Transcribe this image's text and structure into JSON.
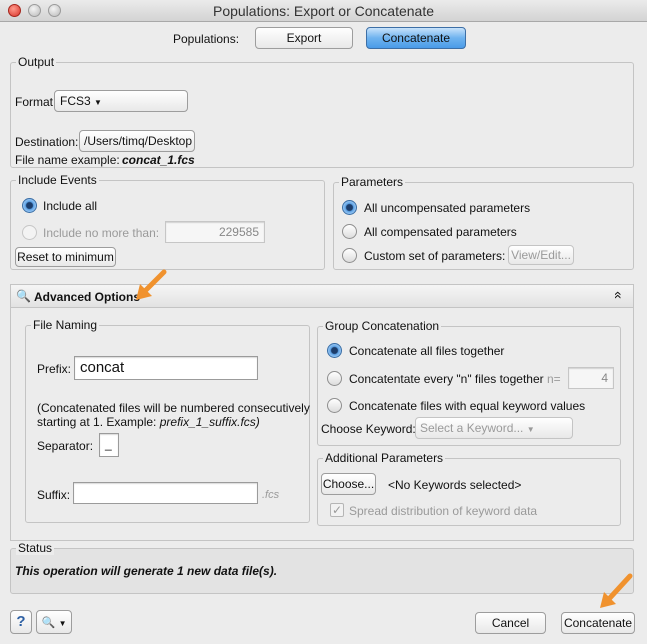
{
  "window": {
    "title": "Populations: Export or Concatenate"
  },
  "populations": {
    "label": "Populations:",
    "export_label": "Export",
    "concatenate_label": "Concatenate"
  },
  "output": {
    "group_title": "Output",
    "format_label": "Format:",
    "format_value": "FCS3",
    "destination_label": "Destination:",
    "destination_value": "/Users/timq/Desktop",
    "filename_example_label": "File name example:",
    "filename_example_value": "concat_1.fcs"
  },
  "include_events": {
    "group_title": "Include Events",
    "include_all": "Include all",
    "include_no_more_than": "Include no more than:",
    "max_value": "229585",
    "reset_label": "Reset to minimum"
  },
  "parameters": {
    "group_title": "Parameters",
    "options": [
      "All uncompensated parameters",
      "All compensated parameters",
      "Custom set of parameters:"
    ],
    "selected_index": 0,
    "view_edit_label": "View/Edit..."
  },
  "advanced": {
    "title": "Advanced Options",
    "collapse_glyph": "«"
  },
  "file_naming": {
    "group_title": "File Naming",
    "prefix_label": "Prefix:",
    "prefix_value": "concat",
    "note_line1": "(Concatenated files will be numbered consecutively",
    "note_line2_prefix": "starting at 1. Example: ",
    "note_line2_example": "prefix_1_suffix.fcs)",
    "separator_label": "Separator:",
    "separator_value": "_",
    "suffix_label": "Suffix:",
    "suffix_value": "",
    "suffix_ext": ".fcs"
  },
  "group_concat": {
    "group_title": "Group Concatenation",
    "options": [
      "Concatenate all files together",
      "Concatentate every \"n\" files together",
      "Concatenate files with equal keyword values"
    ],
    "selected_index": 0,
    "n_label": "n=",
    "n_value": "4",
    "choose_keyword_label": "Choose Keyword:",
    "keyword_placeholder": "Select a Keyword..."
  },
  "additional_params": {
    "group_title": "Additional Parameters",
    "choose_label": "Choose...",
    "no_keywords": "<No Keywords selected>",
    "spread_label": "Spread distribution of keyword data",
    "spread_checked": true
  },
  "status": {
    "group_title": "Status",
    "message": "This operation will generate 1 new data file(s)."
  },
  "footer": {
    "help_glyph": "?",
    "cancel_label": "Cancel",
    "concatenate_label": "Concatenate"
  },
  "colors": {
    "accent_arrow": "#f0922e",
    "selected_button": "#4a9be8"
  }
}
